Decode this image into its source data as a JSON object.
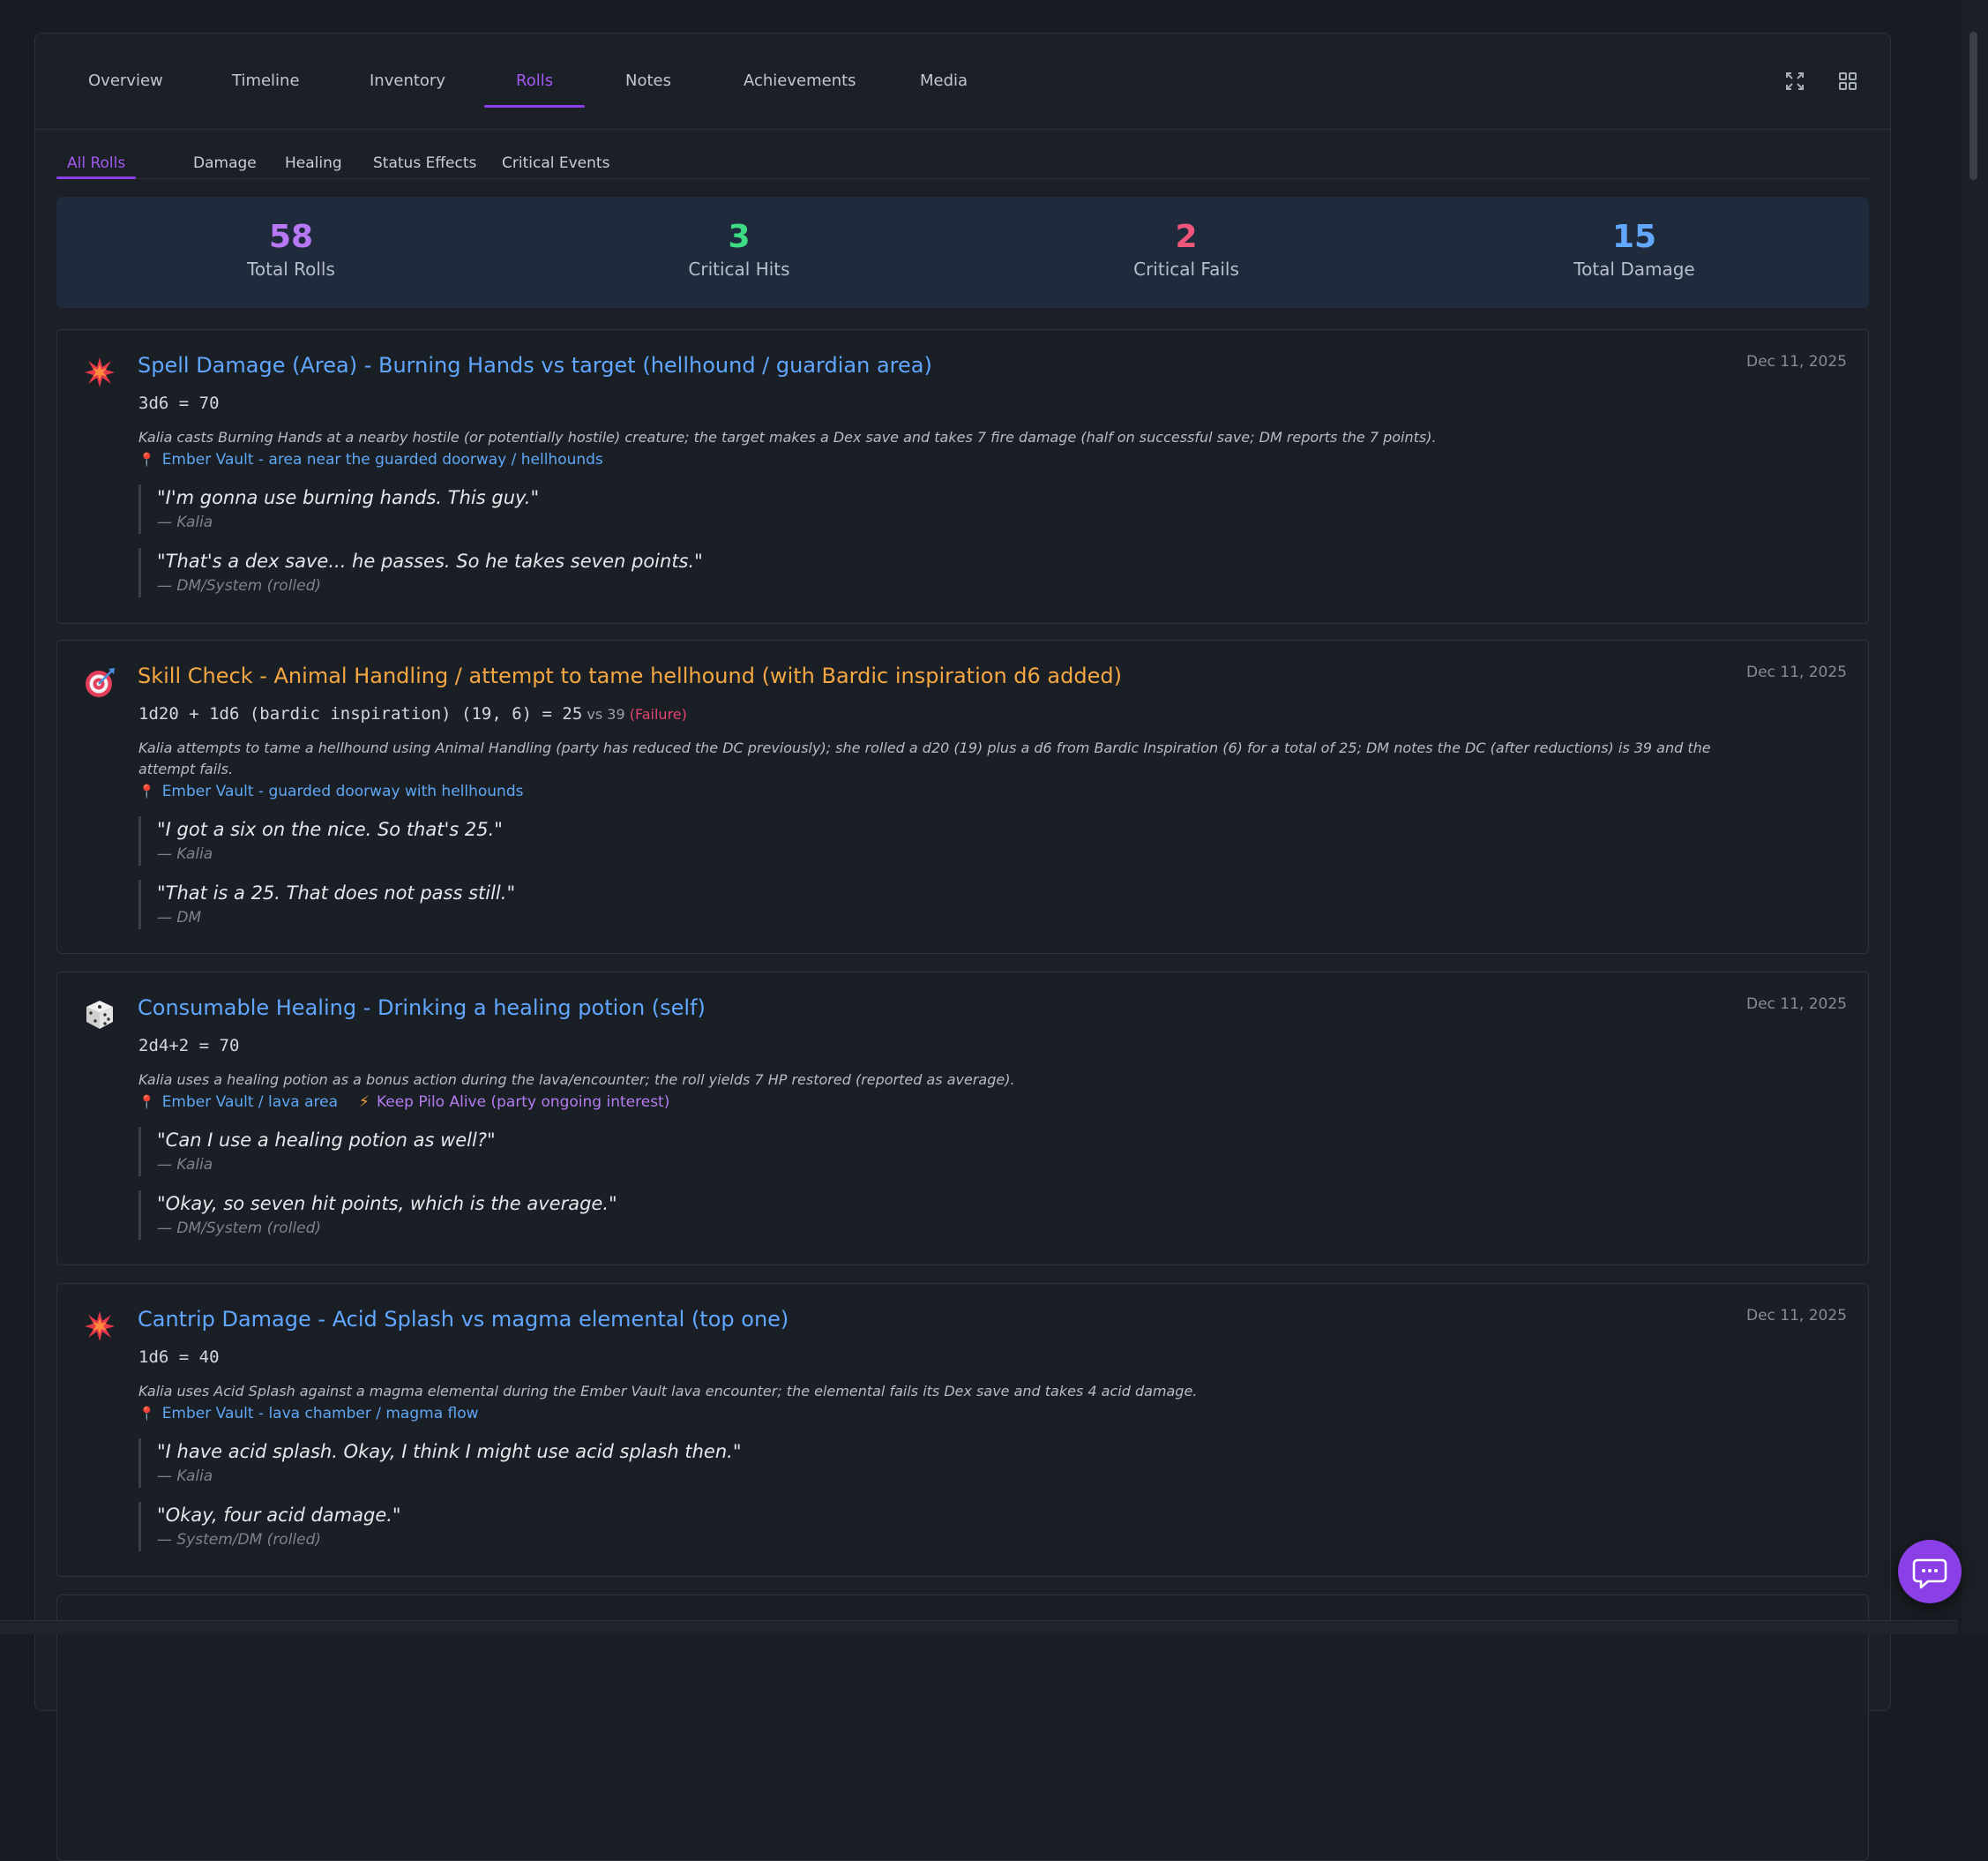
{
  "nav": {
    "tabs": [
      {
        "label": "Overview"
      },
      {
        "label": "Timeline"
      },
      {
        "label": "Inventory"
      },
      {
        "label": "Rolls"
      },
      {
        "label": "Notes"
      },
      {
        "label": "Achievements"
      },
      {
        "label": "Media"
      }
    ],
    "active_tab": "Rolls",
    "icons": [
      "expand-icon",
      "grid-icon"
    ]
  },
  "subtabs": {
    "items": [
      {
        "label": "All Rolls"
      },
      {
        "label": "Damage"
      },
      {
        "label": "Healing"
      },
      {
        "label": "Status Effects"
      },
      {
        "label": "Critical Events"
      }
    ],
    "active": "All Rolls"
  },
  "stats": [
    {
      "value": "58",
      "label": "Total Rolls",
      "color": "#b877f5"
    },
    {
      "value": "3",
      "label": "Critical Hits",
      "color": "#3ddc84"
    },
    {
      "value": "2",
      "label": "Critical Fails",
      "color": "#f0567a"
    },
    {
      "value": "15",
      "label": "Total Damage",
      "color": "#62a8ff"
    }
  ],
  "rolls": [
    {
      "icon": "burst-icon",
      "title_type": "Spell Damage (Area)",
      "title_sep": " - ",
      "title_detail": "Burning Hands vs target (hellhound / guardian area)",
      "date": "Dec 11, 2025",
      "formula": "3d6",
      "result": " = 70",
      "description": "Kalia casts Burning Hands at a nearby hostile (or potentially hostile) creature; the target makes a Dex save and takes 7 fire damage (half on successful save; DM reports the 7 points).",
      "location": "Ember Vault - area near the guarded doorway / hellhounds",
      "quotes": [
        {
          "text": "\"I'm gonna use burning hands. This guy.\"",
          "author": "— Kalia"
        },
        {
          "text": "\"That's a dex save... he passes. So he takes seven points.\"",
          "author": "— DM/System (rolled)"
        }
      ]
    },
    {
      "icon": "target-icon",
      "title_type": "Skill Check",
      "title_sep": " - ",
      "title_detail": "Animal Handling / attempt to tame hellhound (with Bardic inspiration d6 added)",
      "date": "Dec 11, 2025",
      "formula": "1d20 + 1d6 (bardic inspiration) (19, 6) = 25",
      "vs": " vs 39",
      "outcome": " (Failure)",
      "description": "Kalia attempts to tame a hellhound using Animal Handling (party has reduced the DC previously); she rolled a d20 (19) plus a d6 from Bardic Inspiration (6) for a total of 25; DM notes the DC (after reductions) is 39 and the attempt fails.",
      "location": "Ember Vault - guarded doorway with hellhounds",
      "quotes": [
        {
          "text": "\"I got a six on the nice. So that's 25.\"",
          "author": "— Kalia"
        },
        {
          "text": "\"That is a 25. That does not pass still.\"",
          "author": "— DM"
        }
      ]
    },
    {
      "icon": "dice-icon",
      "title_type": "Consumable Healing",
      "title_sep": " - ",
      "title_detail": "Drinking a healing potion (self)",
      "date": "Dec 11, 2025",
      "formula": "2d4+2",
      "result": " = 70",
      "description": "Kalia uses a healing potion as a bonus action during the lava/encounter; the roll yields 7 HP restored (reported as average).",
      "location": "Ember Vault / lava area",
      "quest": "Keep Pilo Alive (party ongoing interest)",
      "quotes": [
        {
          "text": "\"Can I use a healing potion as well?\"",
          "author": "— Kalia"
        },
        {
          "text": "\"Okay, so seven hit points, which is the average.\"",
          "author": "— DM/System (rolled)"
        }
      ]
    },
    {
      "icon": "burst-icon",
      "title_type": "Cantrip Damage",
      "title_sep": " - ",
      "title_detail": "Acid Splash vs magma elemental (top one)",
      "date": "Dec 11, 2025",
      "formula": "1d6",
      "result": " = 40",
      "description": "Kalia uses Acid Splash against a magma elemental during the Ember Vault lava encounter; the elemental fails its Dex save and takes 4 acid damage.",
      "location": "Ember Vault - lava chamber / magma flow",
      "quotes": [
        {
          "text": "\"I have acid splash. Okay, I think I might use acid splash then.\"",
          "author": "— Kalia"
        },
        {
          "text": "\"Okay, four acid damage.\"",
          "author": "— System/DM (rolled)"
        }
      ]
    }
  ],
  "colors": {
    "accent": "#8b3fe6",
    "link": "#61a7ff",
    "skill": "#f4a742",
    "fail": "#e2456f"
  }
}
